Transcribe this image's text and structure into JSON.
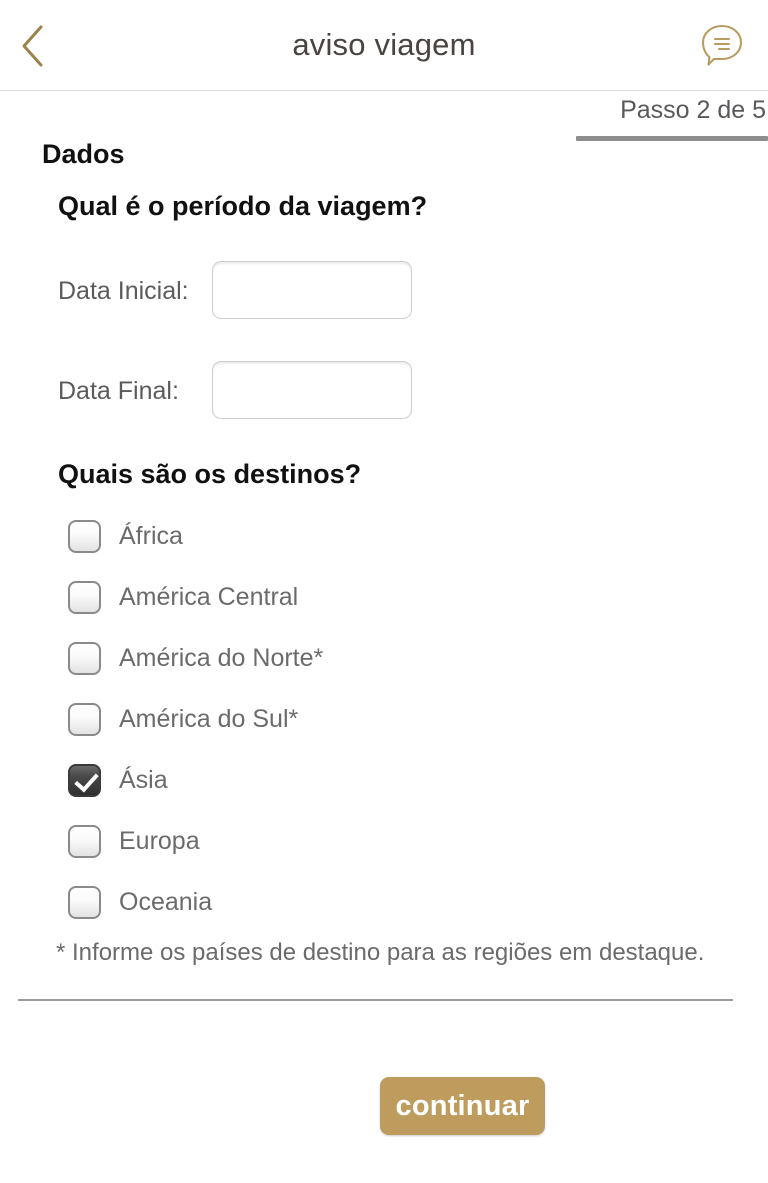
{
  "header": {
    "back_icon": "chevron-left-icon",
    "title": "aviso viagem",
    "chat_icon": "chat-bubble-icon",
    "accent_color": "#a48a4f"
  },
  "progress": {
    "label": "Passo 2 de 5",
    "current_step": 2,
    "total_steps": 5,
    "bar_color": "#8e8e8e"
  },
  "form": {
    "section_title": "Dados",
    "question_period": "Qual é o período da viagem?",
    "fields": [
      {
        "label": "Data Inicial:",
        "value": "",
        "placeholder": ""
      },
      {
        "label": "Data Final:",
        "value": "",
        "placeholder": ""
      }
    ],
    "question_destinations": "Quais são os destinos?",
    "destinations": [
      {
        "label": "África",
        "checked": false
      },
      {
        "label": "América Central",
        "checked": false
      },
      {
        "label": "América do Norte*",
        "checked": false
      },
      {
        "label": "América do Sul*",
        "checked": false
      },
      {
        "label": "Ásia",
        "checked": true
      },
      {
        "label": "Europa",
        "checked": false
      },
      {
        "label": "Oceania",
        "checked": false
      }
    ],
    "footnote": "* Informe os países de destino para as regiões em destaque."
  },
  "actions": {
    "continue_label": "continuar",
    "continue_color": "#be9c5d"
  }
}
